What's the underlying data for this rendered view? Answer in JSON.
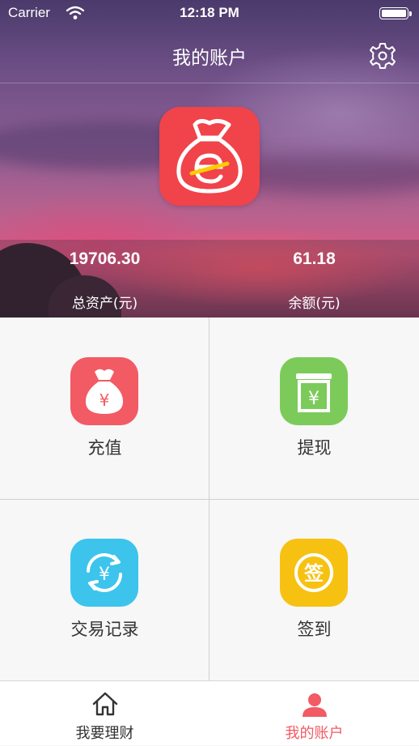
{
  "status_bar": {
    "carrier": "Carrier",
    "time": "12:18 PM"
  },
  "nav": {
    "title": "我的账户"
  },
  "account": {
    "total_assets": {
      "value": "19706.30",
      "label": "总资产(元)"
    },
    "balance": {
      "value": "61.18",
      "label": "余额(元)"
    }
  },
  "actions": [
    {
      "label": "充值",
      "icon": "money-bag-icon",
      "color": "#f25a64"
    },
    {
      "label": "提现",
      "icon": "withdraw-box-icon",
      "color": "#7ccb5a"
    },
    {
      "label": "交易记录",
      "icon": "yen-exchange-icon",
      "color": "#3cc4ec"
    },
    {
      "label": "签到",
      "icon": "sign-in-stamp-icon",
      "color": "#f7c112"
    }
  ],
  "tabs": [
    {
      "label": "我要理财",
      "icon": "home-icon",
      "active": false,
      "color": "#333333"
    },
    {
      "label": "我的账户",
      "icon": "person-icon",
      "active": true,
      "color": "#f25a64"
    }
  ],
  "colors": {
    "accent": "#f25a64",
    "logo_bg": "#f1434a"
  }
}
